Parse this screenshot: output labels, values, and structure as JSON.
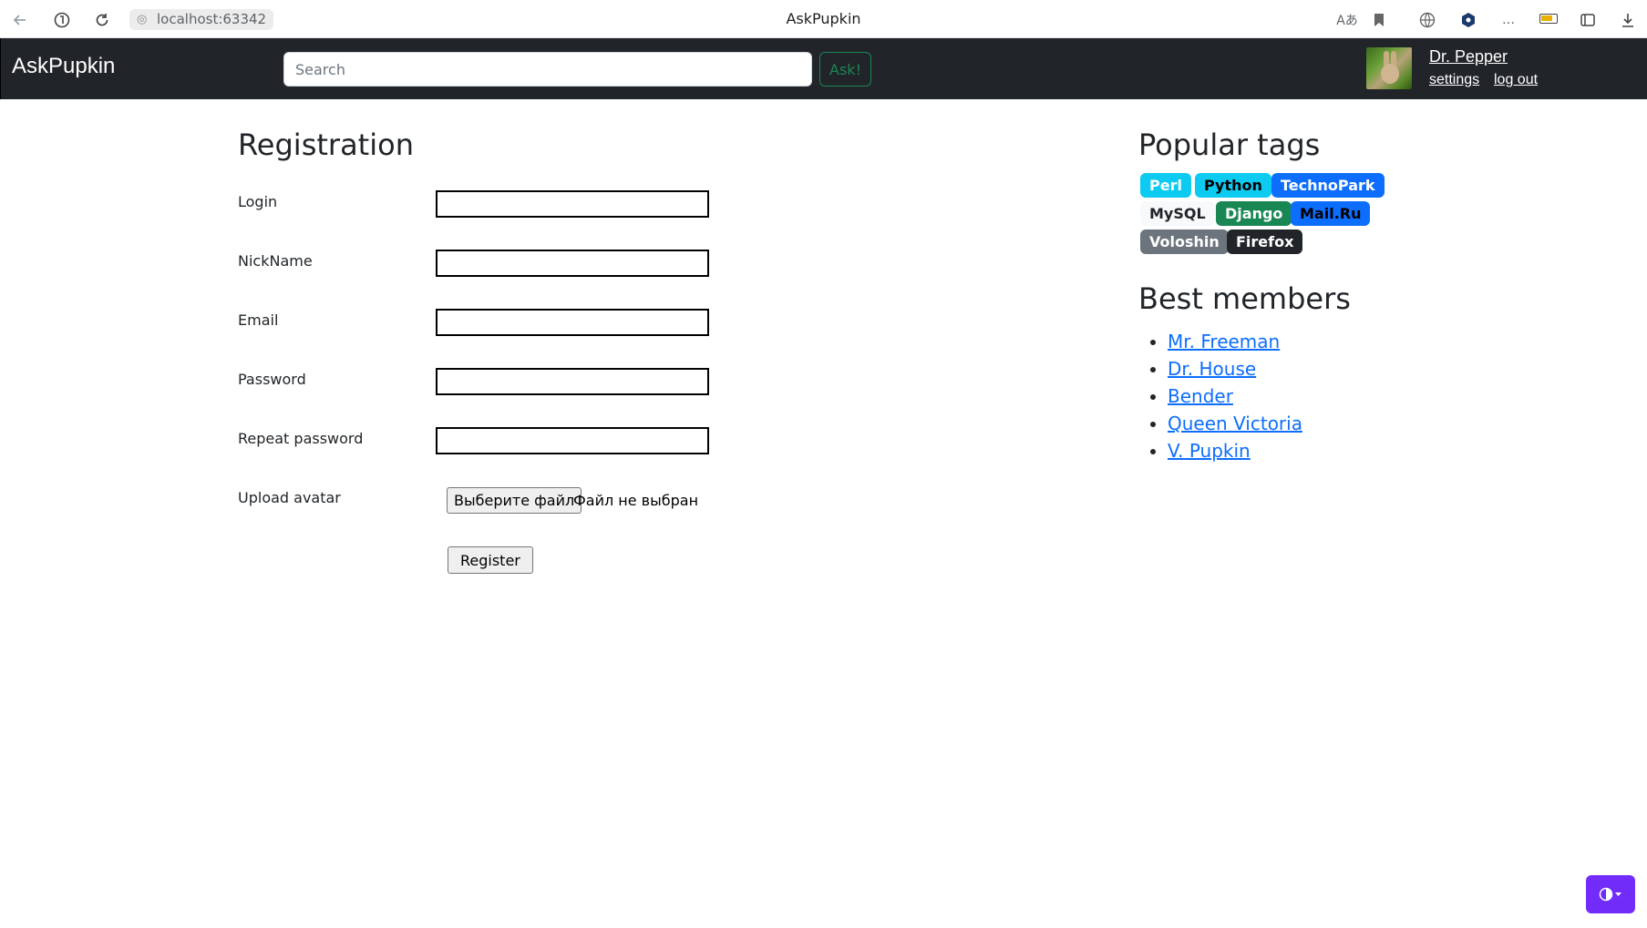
{
  "browser": {
    "url": "localhost:63342",
    "tab_title": "AskPupkin"
  },
  "navbar": {
    "brand": "AskPupkin",
    "search_placeholder": "Search",
    "ask_label": "Ask!",
    "user_name": "Dr. Pepper",
    "settings_label": "settings",
    "logout_label": "log out"
  },
  "registration": {
    "title": "Registration",
    "fields": [
      {
        "label": "Login",
        "value": ""
      },
      {
        "label": "NickName",
        "value": ""
      },
      {
        "label": "Email",
        "value": ""
      },
      {
        "label": "Password",
        "value": ""
      },
      {
        "label": "Repeat password",
        "value": ""
      }
    ],
    "avatar_label": "Upload avatar",
    "file_button_label": "Выберите файл",
    "file_status": "Файл не выбран",
    "register_label": "Register"
  },
  "sidebar": {
    "tags_title": "Popular tags",
    "tags": [
      {
        "label": "Perl",
        "bg": "#0dcaf0",
        "color": "#ffffff"
      },
      {
        "label": "Python",
        "bg": "#0dcaf0",
        "color": "#000000"
      },
      {
        "label": "TechnoPark",
        "bg": "#0d6efd",
        "color": "#ffffff"
      },
      {
        "label": "MySQL",
        "bg": "#f8f9fa",
        "color": "#212529"
      },
      {
        "label": "Django",
        "bg": "#198754",
        "color": "#ffffff"
      },
      {
        "label": "Mail.Ru",
        "bg": "#0d6efd",
        "color": "#000000"
      },
      {
        "label": "Voloshin",
        "bg": "#6c757d",
        "color": "#ffffff"
      },
      {
        "label": "Firefox",
        "bg": "#212529",
        "color": "#ffffff"
      }
    ],
    "members_title": "Best members",
    "members": [
      "Mr. Freeman",
      "Dr. House",
      "Bender",
      "Queen Victoria",
      "V. Pupkin"
    ]
  },
  "colors": {
    "navbar_bg": "#212529",
    "link": "#0d6efd",
    "success": "#198754",
    "theme_toggle": "#712cf9"
  },
  "icons": [
    "back-arrow-icon",
    "yandex-icon",
    "reload-icon",
    "site-info-icon",
    "translate-icon",
    "bookmark-icon",
    "globe-icon",
    "extension-icon",
    "more-icon",
    "battery-icon",
    "collections-icon",
    "download-icon",
    "theme-toggle-icon"
  ]
}
